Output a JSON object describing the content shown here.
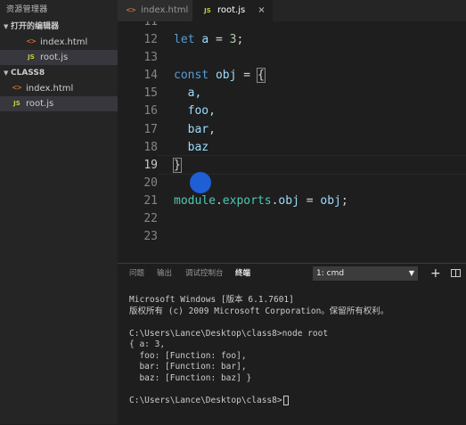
{
  "sidebar": {
    "title": "资源管理器",
    "open_editors": {
      "header": "打开的编辑器",
      "items": [
        {
          "icon": "html-file-icon",
          "label": "index.html"
        },
        {
          "icon": "js-file-icon",
          "label": "root.js"
        }
      ]
    },
    "folder": {
      "header": "CLASS8",
      "items": [
        {
          "icon": "html-file-icon",
          "label": "index.html"
        },
        {
          "icon": "js-file-icon",
          "label": "root.js"
        }
      ]
    },
    "icon_glyphs": {
      "html": "<>",
      "js": "JS"
    }
  },
  "tabs": [
    {
      "label": "index.html",
      "icon": "html-file-icon"
    },
    {
      "label": "root.js",
      "icon": "js-file-icon",
      "active": true,
      "close": "×"
    }
  ],
  "editor": {
    "line_numbers": [
      "11",
      "12",
      "13",
      "14",
      "15",
      "16",
      "17",
      "18",
      "19",
      "20",
      "21",
      "22",
      "23"
    ],
    "active_line": "19",
    "code": {
      "l12_kw": "let",
      "l12_var": "a",
      "l12_op": " = ",
      "l12_num": "3",
      "l12_end": ";",
      "l14_kw": "const",
      "l14_var": "obj",
      "l14_op": " = ",
      "l14_brace": "{",
      "l15": "a,",
      "l16": "foo,",
      "l17": "bar,",
      "l18": "baz",
      "l19_brace": "}",
      "l21_mod": "module",
      "l21_dot1": ".",
      "l21_prop": "exports",
      "l21_dot2": ".",
      "l21_var": "obj",
      "l21_op": " = ",
      "l21_val": "obj",
      "l21_end": ";"
    }
  },
  "panel": {
    "tabs": [
      "问题",
      "输出",
      "调试控制台",
      "终端"
    ],
    "active_tab": "终端",
    "terminal_select": "1: cmd",
    "add_label": "+",
    "terminal_lines": [
      "Microsoft Windows [版本 6.1.7601]",
      "版权所有 (c) 2009 Microsoft Corporation。保留所有权利。",
      "",
      "C:\\Users\\Lance\\Desktop\\class8>node root",
      "{ a: 3,",
      "  foo: [Function: foo],",
      "  bar: [Function: bar],",
      "  baz: [Function: baz] }",
      "",
      "C:\\Users\\Lance\\Desktop\\class8>"
    ]
  },
  "colors": {
    "background": "#1e1e1e",
    "sidebar": "#252526",
    "keyword": "#569cd6",
    "variable": "#9cdcfe",
    "number": "#b5cea8",
    "module": "#4ec9b0",
    "cursor_dot": "#1e5fd6"
  }
}
